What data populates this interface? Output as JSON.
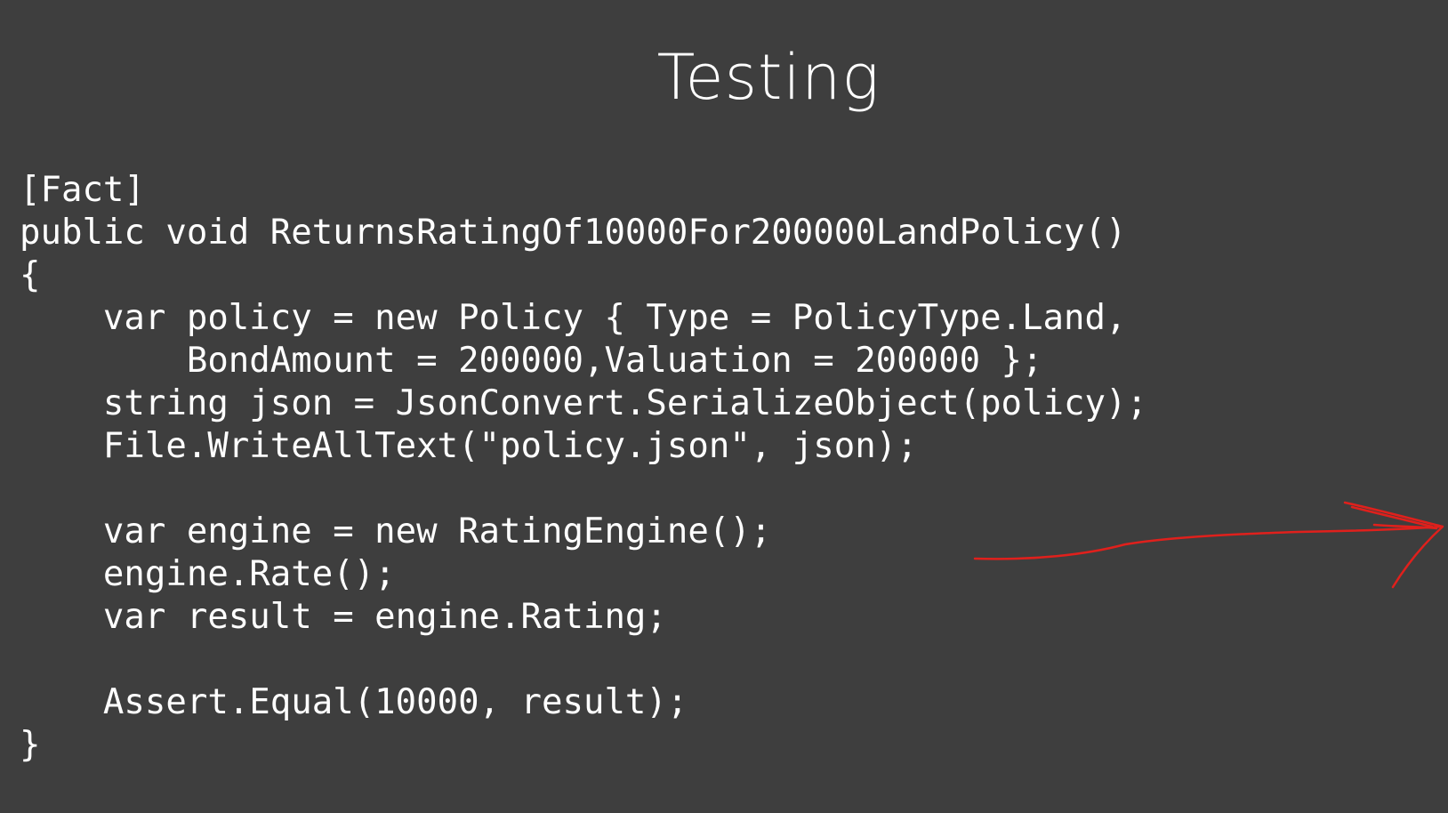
{
  "slide": {
    "title": "Testing",
    "code_lines": [
      "[Fact]",
      "public void ReturnsRatingOf10000For200000LandPolicy()",
      "{",
      "    var policy = new Policy { Type = PolicyType.Land,",
      "        BondAmount = 200000,Valuation = 200000 };",
      "    string json = JsonConvert.SerializeObject(policy);",
      "    File.WriteAllText(\"policy.json\", json);",
      "",
      "    var engine = new RatingEngine();",
      "    engine.Rate();",
      "    var result = engine.Rating;",
      "",
      "    Assert.Equal(10000, result);",
      "}"
    ],
    "annotation": {
      "icon": "hand-drawn-arrow-icon",
      "color": "#e0201c"
    }
  },
  "colors": {
    "background": "#3e3e3e",
    "text": "#ffffff"
  }
}
